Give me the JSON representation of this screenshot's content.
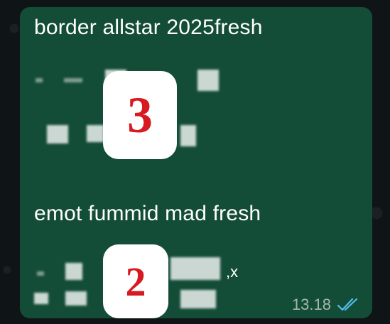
{
  "message": {
    "line1": "border allstar 2025fresh",
    "line2": "emot fummid mad fresh",
    "badge_top": "3",
    "badge_bottom": "2",
    "trailing_text": ",x",
    "time": "13.18",
    "status": "read",
    "status_icon": "double-check-icon"
  },
  "colors": {
    "bubble": "#144d37",
    "background": "#0f1417",
    "badge_number": "#d71920",
    "ticks": "#53bdeb"
  }
}
